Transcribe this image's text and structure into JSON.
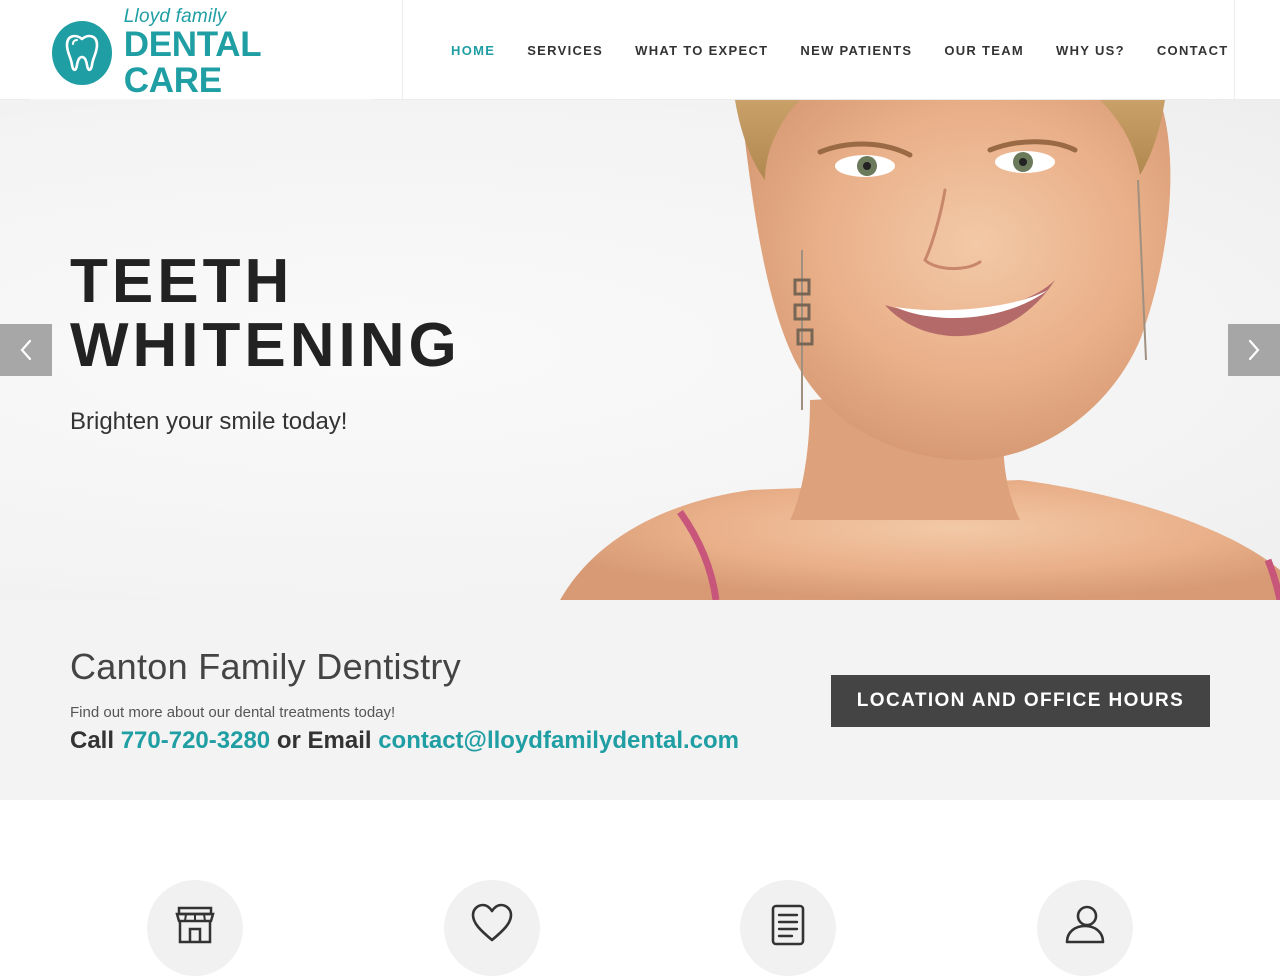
{
  "brand": {
    "small": "Lloyd family",
    "big": "DENTAL CARE",
    "accent": "#1f9ea3"
  },
  "nav": {
    "items": [
      {
        "label": "HOME",
        "active": true
      },
      {
        "label": "SERVICES",
        "active": false
      },
      {
        "label": "WHAT TO EXPECT",
        "active": false
      },
      {
        "label": "NEW PATIENTS",
        "active": false
      },
      {
        "label": "OUR TEAM",
        "active": false
      },
      {
        "label": "WHY US?",
        "active": false
      },
      {
        "label": "CONTACT",
        "active": false
      }
    ]
  },
  "hero": {
    "title_line1": "TEETH",
    "title_line2": "WHITENING",
    "subtitle": "Brighten your smile today!",
    "prev_icon": "chevron-left-icon",
    "next_icon": "chevron-right-icon"
  },
  "info": {
    "title": "Canton Family Dentistry",
    "description": "Find out more about our dental treatments today!",
    "call_label": "Call",
    "phone": "770-720-3280",
    "or_email_label": "or Email",
    "email": "contact@lloydfamilydental.com",
    "cta_label": "LOCATION AND OFFICE HOURS",
    "cta_bg": "#444444"
  },
  "features": {
    "icons": [
      "storefront-icon",
      "heart-icon",
      "document-icon",
      "person-icon"
    ]
  }
}
